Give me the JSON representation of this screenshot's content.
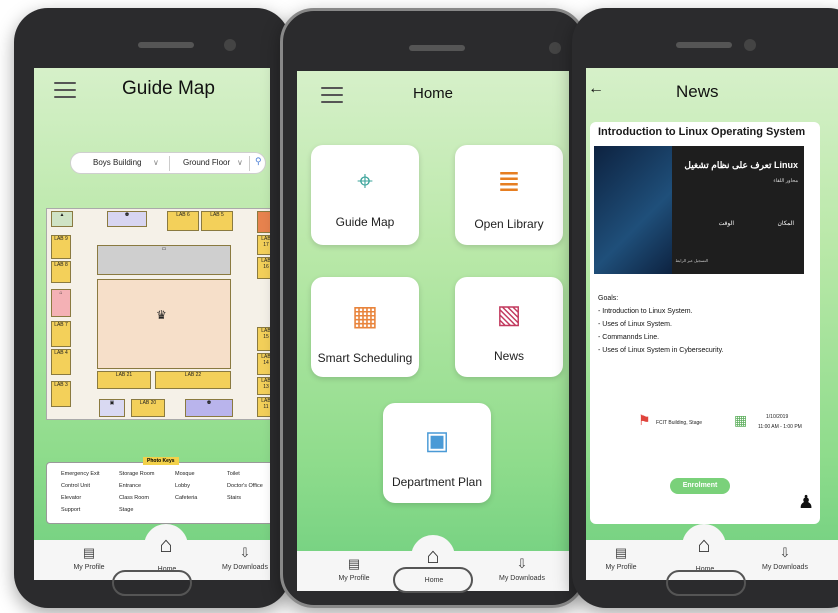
{
  "guide": {
    "title": "Guide Map",
    "building": "Boys Building",
    "floor": "Ground Floor",
    "keys_header": "Photo Keys",
    "keys": [
      "Emergency Exit",
      "Control Unit",
      "Elevator",
      "Support",
      "Storage Room",
      "Entrance",
      "Class Room",
      "Stage",
      "Mosque",
      "Lobby",
      "Cafeteria",
      "Toilet",
      "Doctor's Office",
      "Stairs"
    ],
    "labs": [
      "LAB 6",
      "LAB 5",
      "LAB 9",
      "LAB 8",
      "LAB 7",
      "LAB 4",
      "LAB 3",
      "LAB 21",
      "LAB 22",
      "LAB 20",
      "LAB 10",
      "LAB 16",
      "LAB 15",
      "LAB 14",
      "LAB 13",
      "LAB 11",
      "LAB 17"
    ]
  },
  "home": {
    "title": "Home",
    "tiles": [
      "Guide Map",
      "Open Library",
      "Smart Scheduling",
      "News",
      "Department Plan"
    ]
  },
  "news": {
    "title": "News",
    "back_icon": "←",
    "card_title": "Introduction to Linux Operating System",
    "poster_title": "تعرف على نظام تشغيل Linux",
    "poster_topics_head": "محاور اللقاء",
    "poster_place": "المكان",
    "poster_time": "الوقت",
    "poster_register": "التسجيل عبر الرابط",
    "goals_head": "Goals:",
    "goals": [
      "- Introduction to Linux System.",
      "- Uses of Linux System.",
      "- Commannds Line.",
      "- Uses of Linux System in Cybersecurity."
    ],
    "location": "FCIT Building, Stage",
    "date": "1/10/2019",
    "time": "11:00 AM - 1:00 PM",
    "enrol": "Enrolment"
  },
  "nav": {
    "profile": "My Profile",
    "home": "Home",
    "downloads": "My Downloads"
  },
  "colors": {
    "screen_green": "#8fdc8c",
    "enrol_green": "#7ad17a",
    "phone_body": "#2b2b2d"
  }
}
